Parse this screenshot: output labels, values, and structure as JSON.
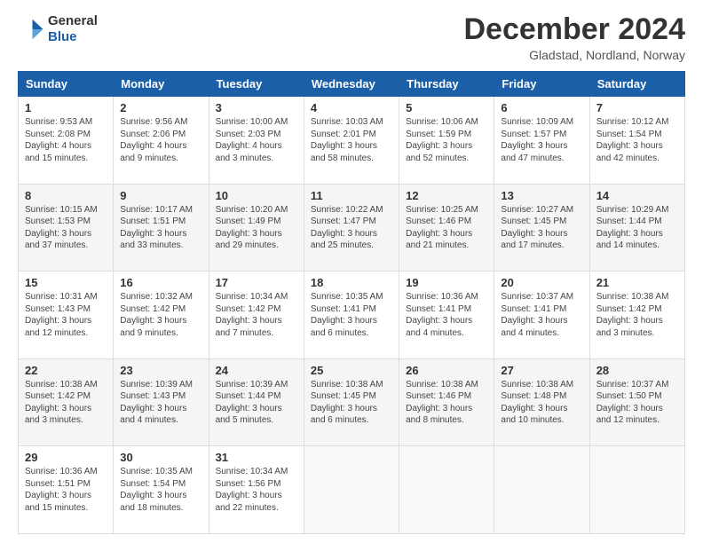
{
  "logo": {
    "line1": "General",
    "line2": "Blue"
  },
  "title": "December 2024",
  "subtitle": "Gladstad, Nordland, Norway",
  "days_of_week": [
    "Sunday",
    "Monday",
    "Tuesday",
    "Wednesday",
    "Thursday",
    "Friday",
    "Saturday"
  ],
  "weeks": [
    [
      {
        "day": "1",
        "info": "Sunrise: 9:53 AM\nSunset: 2:08 PM\nDaylight: 4 hours\nand 15 minutes."
      },
      {
        "day": "2",
        "info": "Sunrise: 9:56 AM\nSunset: 2:06 PM\nDaylight: 4 hours\nand 9 minutes."
      },
      {
        "day": "3",
        "info": "Sunrise: 10:00 AM\nSunset: 2:03 PM\nDaylight: 4 hours\nand 3 minutes."
      },
      {
        "day": "4",
        "info": "Sunrise: 10:03 AM\nSunset: 2:01 PM\nDaylight: 3 hours\nand 58 minutes."
      },
      {
        "day": "5",
        "info": "Sunrise: 10:06 AM\nSunset: 1:59 PM\nDaylight: 3 hours\nand 52 minutes."
      },
      {
        "day": "6",
        "info": "Sunrise: 10:09 AM\nSunset: 1:57 PM\nDaylight: 3 hours\nand 47 minutes."
      },
      {
        "day": "7",
        "info": "Sunrise: 10:12 AM\nSunset: 1:54 PM\nDaylight: 3 hours\nand 42 minutes."
      }
    ],
    [
      {
        "day": "8",
        "info": "Sunrise: 10:15 AM\nSunset: 1:53 PM\nDaylight: 3 hours\nand 37 minutes."
      },
      {
        "day": "9",
        "info": "Sunrise: 10:17 AM\nSunset: 1:51 PM\nDaylight: 3 hours\nand 33 minutes."
      },
      {
        "day": "10",
        "info": "Sunrise: 10:20 AM\nSunset: 1:49 PM\nDaylight: 3 hours\nand 29 minutes."
      },
      {
        "day": "11",
        "info": "Sunrise: 10:22 AM\nSunset: 1:47 PM\nDaylight: 3 hours\nand 25 minutes."
      },
      {
        "day": "12",
        "info": "Sunrise: 10:25 AM\nSunset: 1:46 PM\nDaylight: 3 hours\nand 21 minutes."
      },
      {
        "day": "13",
        "info": "Sunrise: 10:27 AM\nSunset: 1:45 PM\nDaylight: 3 hours\nand 17 minutes."
      },
      {
        "day": "14",
        "info": "Sunrise: 10:29 AM\nSunset: 1:44 PM\nDaylight: 3 hours\nand 14 minutes."
      }
    ],
    [
      {
        "day": "15",
        "info": "Sunrise: 10:31 AM\nSunset: 1:43 PM\nDaylight: 3 hours\nand 12 minutes."
      },
      {
        "day": "16",
        "info": "Sunrise: 10:32 AM\nSunset: 1:42 PM\nDaylight: 3 hours\nand 9 minutes."
      },
      {
        "day": "17",
        "info": "Sunrise: 10:34 AM\nSunset: 1:42 PM\nDaylight: 3 hours\nand 7 minutes."
      },
      {
        "day": "18",
        "info": "Sunrise: 10:35 AM\nSunset: 1:41 PM\nDaylight: 3 hours\nand 6 minutes."
      },
      {
        "day": "19",
        "info": "Sunrise: 10:36 AM\nSunset: 1:41 PM\nDaylight: 3 hours\nand 4 minutes."
      },
      {
        "day": "20",
        "info": "Sunrise: 10:37 AM\nSunset: 1:41 PM\nDaylight: 3 hours\nand 4 minutes."
      },
      {
        "day": "21",
        "info": "Sunrise: 10:38 AM\nSunset: 1:42 PM\nDaylight: 3 hours\nand 3 minutes."
      }
    ],
    [
      {
        "day": "22",
        "info": "Sunrise: 10:38 AM\nSunset: 1:42 PM\nDaylight: 3 hours\nand 3 minutes."
      },
      {
        "day": "23",
        "info": "Sunrise: 10:39 AM\nSunset: 1:43 PM\nDaylight: 3 hours\nand 4 minutes."
      },
      {
        "day": "24",
        "info": "Sunrise: 10:39 AM\nSunset: 1:44 PM\nDaylight: 3 hours\nand 5 minutes."
      },
      {
        "day": "25",
        "info": "Sunrise: 10:38 AM\nSunset: 1:45 PM\nDaylight: 3 hours\nand 6 minutes."
      },
      {
        "day": "26",
        "info": "Sunrise: 10:38 AM\nSunset: 1:46 PM\nDaylight: 3 hours\nand 8 minutes."
      },
      {
        "day": "27",
        "info": "Sunrise: 10:38 AM\nSunset: 1:48 PM\nDaylight: 3 hours\nand 10 minutes."
      },
      {
        "day": "28",
        "info": "Sunrise: 10:37 AM\nSunset: 1:50 PM\nDaylight: 3 hours\nand 12 minutes."
      }
    ],
    [
      {
        "day": "29",
        "info": "Sunrise: 10:36 AM\nSunset: 1:51 PM\nDaylight: 3 hours\nand 15 minutes."
      },
      {
        "day": "30",
        "info": "Sunrise: 10:35 AM\nSunset: 1:54 PM\nDaylight: 3 hours\nand 18 minutes."
      },
      {
        "day": "31",
        "info": "Sunrise: 10:34 AM\nSunset: 1:56 PM\nDaylight: 3 hours\nand 22 minutes."
      },
      {
        "day": "",
        "info": ""
      },
      {
        "day": "",
        "info": ""
      },
      {
        "day": "",
        "info": ""
      },
      {
        "day": "",
        "info": ""
      }
    ]
  ]
}
